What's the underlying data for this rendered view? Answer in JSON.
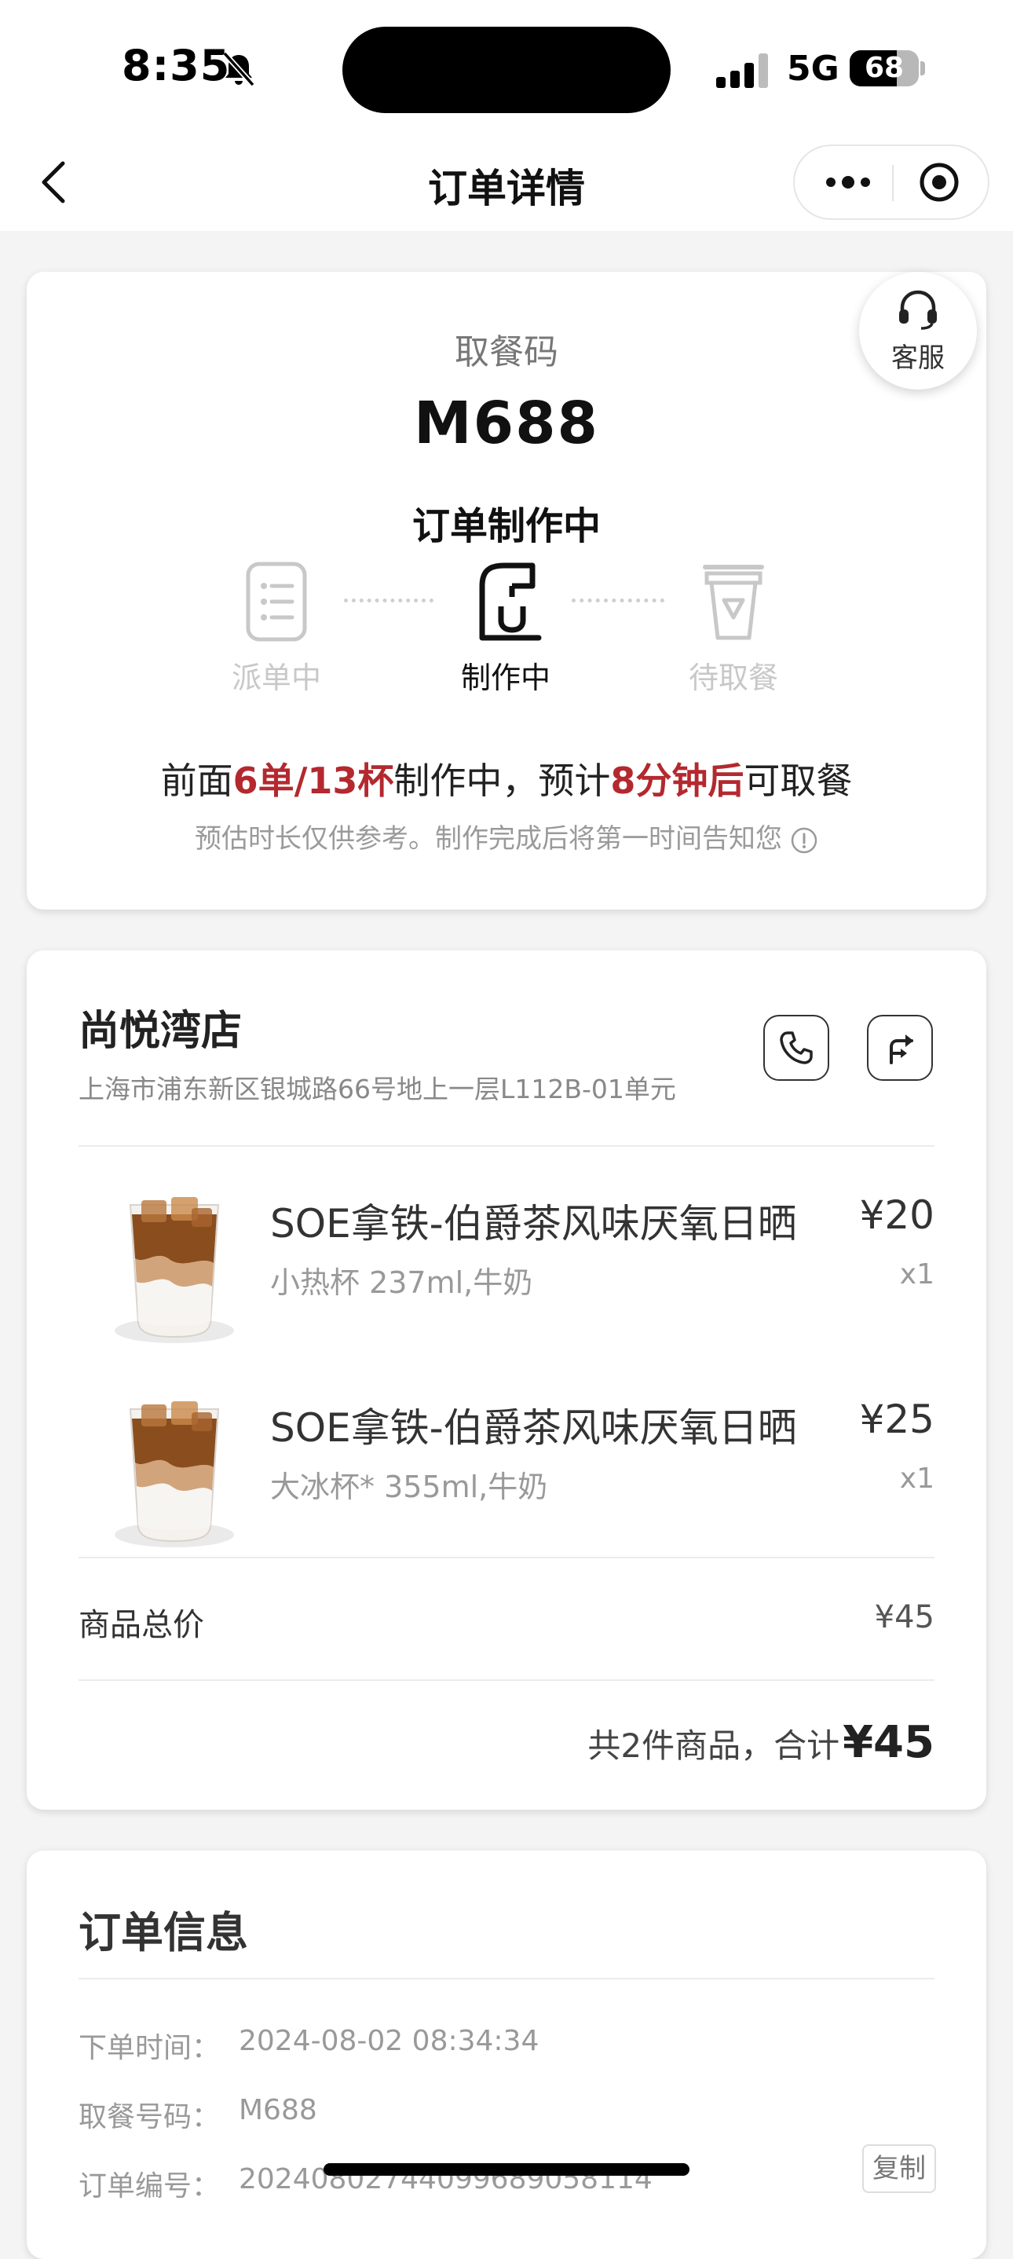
{
  "status_bar": {
    "time": "8:35",
    "network": "5G",
    "battery": "68",
    "battery_level": 0.68
  },
  "nav": {
    "title": "订单详情"
  },
  "status_card": {
    "pickup_label": "取餐码",
    "pickup_code": "M688",
    "order_status": "订单制作中",
    "service_label": "客服",
    "steps": [
      {
        "label": "派单中",
        "state": "done"
      },
      {
        "label": "制作中",
        "state": "active"
      },
      {
        "label": "待取餐",
        "state": "pending"
      }
    ],
    "wait": {
      "prefix": "前面",
      "queue": "6单/13杯",
      "middle": "制作中，预计",
      "eta": "8分钟后",
      "suffix": "可取餐"
    },
    "note": "预估时长仅供参考。制作完成后将第一时间告知您"
  },
  "store": {
    "name": "尚悦湾店",
    "address": "上海市浦东新区银城路66号地上一层L112B-01单元",
    "products": [
      {
        "name": "SOE拿铁-伯爵茶风味厌氧日晒",
        "spec": "小热杯 237ml,牛奶",
        "price": "¥20",
        "qty": "x1"
      },
      {
        "name": "SOE拿铁-伯爵茶风味厌氧日晒",
        "spec": "大冰杯* 355ml,牛奶",
        "price": "¥25",
        "qty": "x1"
      }
    ],
    "subtotal_label": "商品总价",
    "subtotal_value": "¥45",
    "total_text": "共2件商品，合计",
    "total_amount": "¥45"
  },
  "order_info": {
    "title": "订单信息",
    "rows": [
      {
        "label": "下单时间：",
        "value": "2024-08-02 08:34:34"
      },
      {
        "label": "取餐号码：",
        "value": "M688"
      },
      {
        "label": "订单编号：",
        "value": "20240802744099689058114"
      }
    ],
    "copy_label": "复制"
  },
  "colors": {
    "highlight": "#b3292f",
    "background": "#f4f4f4"
  }
}
